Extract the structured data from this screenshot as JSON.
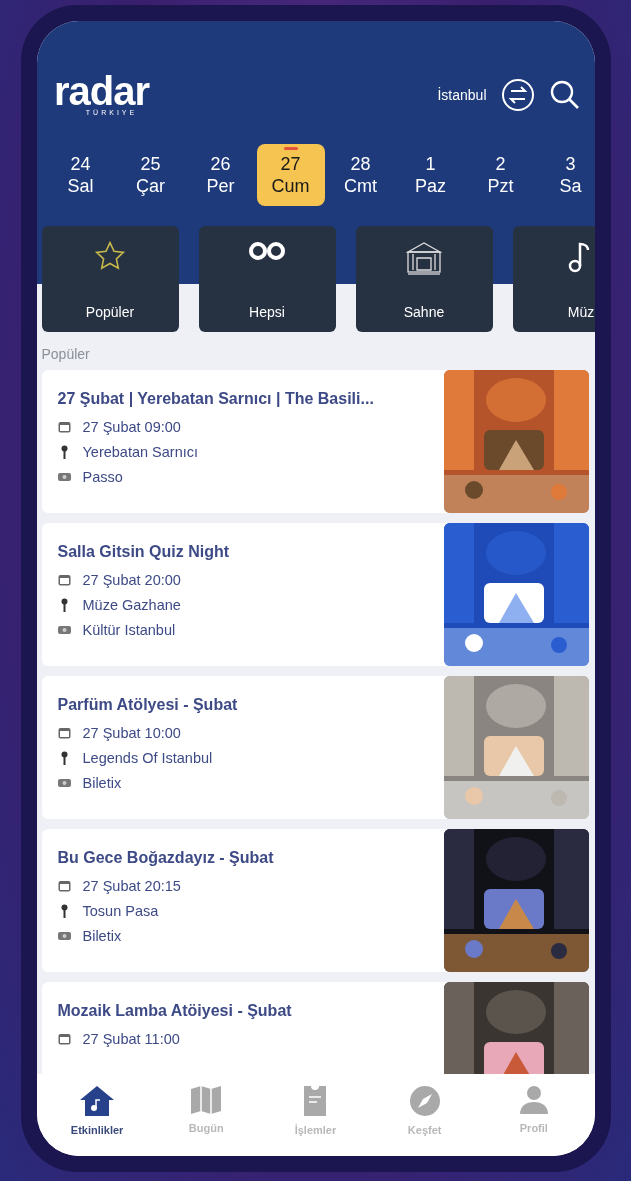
{
  "header": {
    "logo": "radar",
    "logo_sub": "TÜRKIYE",
    "city": "İstanbul"
  },
  "dates": [
    {
      "day": "24",
      "weekday": "Sal",
      "selected": false
    },
    {
      "day": "25",
      "weekday": "Çar",
      "selected": false
    },
    {
      "day": "26",
      "weekday": "Per",
      "selected": false
    },
    {
      "day": "27",
      "weekday": "Cum",
      "selected": true
    },
    {
      "day": "28",
      "weekday": "Cmt",
      "selected": false
    },
    {
      "day": "1",
      "weekday": "Paz",
      "selected": false
    },
    {
      "day": "2",
      "weekday": "Pzt",
      "selected": false
    },
    {
      "day": "3",
      "weekday": "Sa",
      "selected": false
    }
  ],
  "categories": [
    {
      "kind": "star",
      "label": "Popüler"
    },
    {
      "kind": "infinity",
      "label": "Hepsi"
    },
    {
      "kind": "stage",
      "label": "Sahne"
    },
    {
      "kind": "music",
      "label": "Müz"
    }
  ],
  "section_title": "Popüler",
  "events": [
    {
      "title": "27 Şubat | Yerebatan Sarnıcı | The Basili...",
      "date": "27 Şubat 09:00",
      "venue": "Yerebatan Sarnıcı",
      "seller": "Passo"
    },
    {
      "title": "Salla Gitsin Quiz Night",
      "date": "27 Şubat 20:00",
      "venue": "Müze Gazhane",
      "seller": "Kültür Istanbul"
    },
    {
      "title": "Parfüm Atölyesi - Şubat",
      "date": "27 Şubat 10:00",
      "venue": "Legends Of Istanbul",
      "seller": "Biletix"
    },
    {
      "title": "Bu Gece Boğazdayız - Şubat",
      "date": "27 Şubat 20:15",
      "venue": "Tosun Pasa",
      "seller": "Biletix"
    },
    {
      "title": "Mozaik Lamba Atöiyesi - Şubat",
      "date": "27 Şubat 11:00"
    }
  ],
  "tab_bar": [
    {
      "kind": "home",
      "label": "Etkinlikler",
      "selected": true
    },
    {
      "kind": "map",
      "label": "Bugün",
      "selected": false
    },
    {
      "kind": "ticket",
      "label": "İşlemler",
      "selected": false
    },
    {
      "kind": "compass",
      "label": "Keşfet",
      "selected": false
    },
    {
      "kind": "profile",
      "label": "Profil",
      "selected": false
    }
  ]
}
